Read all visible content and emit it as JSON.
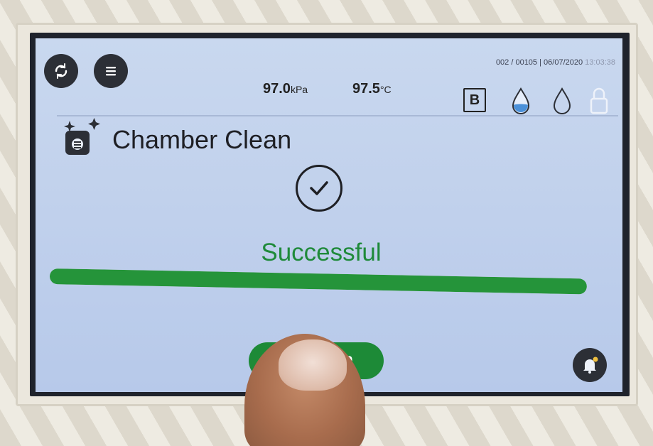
{
  "status_bar": {
    "sync_icon": "sync-icon",
    "menu_icon": "menu-icon",
    "pressure_value": "97.0",
    "pressure_unit": "kPa",
    "temperature_value": "97.5",
    "temperature_unit": "°C",
    "cycle_counter": "002 / 00105",
    "date": "06/07/2020",
    "time": "13:03:38",
    "mode_badge": "B",
    "icons": [
      "water-drop-icon",
      "water-drop-outline-icon",
      "lock-icon"
    ]
  },
  "header": {
    "icon": "chamber-clean-icon",
    "title": "Chamber Clean"
  },
  "result": {
    "icon": "checkmark-icon",
    "status": "Successful",
    "progress": 1.0
  },
  "actions": {
    "confirm_label": "Confirm",
    "corner_icon": "notification-bell-icon"
  },
  "colors": {
    "accent_green": "#1d8a37",
    "screen_bg": "#c1d1ec",
    "icon_dark": "#2c2f36",
    "drop_blue": "#4a90d9"
  }
}
